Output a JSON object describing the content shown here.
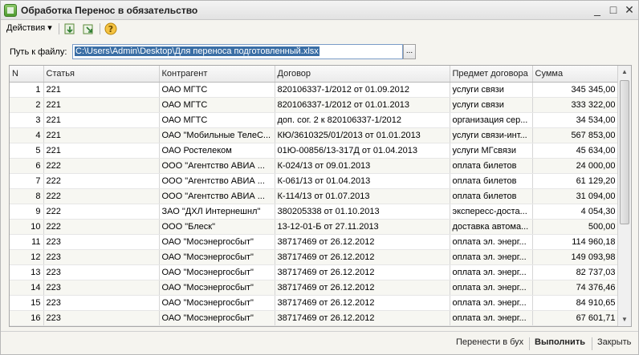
{
  "window": {
    "title": "Обработка  Перенос в обязательство",
    "minimize_glyph": "_",
    "maximize_glyph": "□",
    "close_glyph": "✕"
  },
  "toolbar": {
    "actions_label": "Действия ▾",
    "icons": [
      "load-icon",
      "export-icon",
      "help-icon"
    ]
  },
  "path": {
    "label": "Путь к файлу:",
    "value": "C:\\Users\\Admin\\Desktop\\Для переноса подготовленный.xlsx",
    "browse_label": "..."
  },
  "table": {
    "columns": [
      "N",
      "Статья",
      "Контрагент",
      "Договор",
      "Предмет договора",
      "Сумма"
    ],
    "rows": [
      [
        "1",
        "221",
        "ОАО МГТС",
        "820106337-1/2012 от 01.09.2012",
        "услуги связи",
        "345 345,00"
      ],
      [
        "2",
        "221",
        "ОАО МГТС",
        "820106337-1/2012 от 01.01.2013",
        "услуги связи",
        "333 322,00"
      ],
      [
        "3",
        "221",
        "ОАО МГТС",
        "доп. сог. 2 к 820106337-1/2012",
        "организация сер...",
        "34 534,00"
      ],
      [
        "4",
        "221",
        "ОАО \"Мобильные ТелеС...",
        "КЮ/3610325/01/2013 от 01.01.2013",
        "услуги связи-инт...",
        "567 853,00"
      ],
      [
        "5",
        "221",
        "ОАО Ростелеком",
        "01Ю-00856/13-317Д от 01.04.2013",
        "услуги  МГсвязи",
        "45 634,00"
      ],
      [
        "6",
        "222",
        "ООО \"Агентство АВИА ...",
        "К-024/13 от 09.01.2013",
        "оплата билетов",
        "24 000,00"
      ],
      [
        "7",
        "222",
        "ООО \"Агентство АВИА ...",
        "К-061/13 от 01.04.2013",
        "оплата билетов",
        "61 129,20"
      ],
      [
        "8",
        "222",
        "ООО \"Агентство АВИА ...",
        "К-114/13 от 01.07.2013",
        "оплата билетов",
        "31 094,00"
      ],
      [
        "9",
        "222",
        "ЗАО \"ДХЛ Интернешнл\"",
        "380205338 от 01.10.2013",
        "экспересс-доста...",
        "4 054,30"
      ],
      [
        "10",
        "222",
        "ООО \"Блеск\"",
        "13-12-01-Б от 27.11.2013",
        "доставка автома...",
        "500,00"
      ],
      [
        "11",
        "223",
        "ОАО \"Мосэнергосбыт\"",
        "38717469 от 26.12.2012",
        "оплата эл. энерг...",
        "114 960,18"
      ],
      [
        "12",
        "223",
        "ОАО \"Мосэнергосбыт\"",
        "38717469 от 26.12.2012",
        "оплата эл. энерг...",
        "149 093,98"
      ],
      [
        "13",
        "223",
        "ОАО \"Мосэнергосбыт\"",
        "38717469 от 26.12.2012",
        "оплата эл. энерг...",
        "82 737,03"
      ],
      [
        "14",
        "223",
        "ОАО \"Мосэнергосбыт\"",
        "38717469 от 26.12.2012",
        "оплата эл. энерг...",
        "74 376,46"
      ],
      [
        "15",
        "223",
        "ОАО \"Мосэнергосбыт\"",
        "38717469 от 26.12.2012",
        "оплата эл. энерг...",
        "84 910,65"
      ],
      [
        "16",
        "223",
        "ОАО \"Мосэнергосбыт\"",
        "38717469 от 26.12.2012",
        "оплата эл. энерг...",
        "67 601,71"
      ]
    ]
  },
  "footer": {
    "transfer_label": "Перенести в бух",
    "execute_label": "Выполнить",
    "close_label": "Закрыть"
  }
}
